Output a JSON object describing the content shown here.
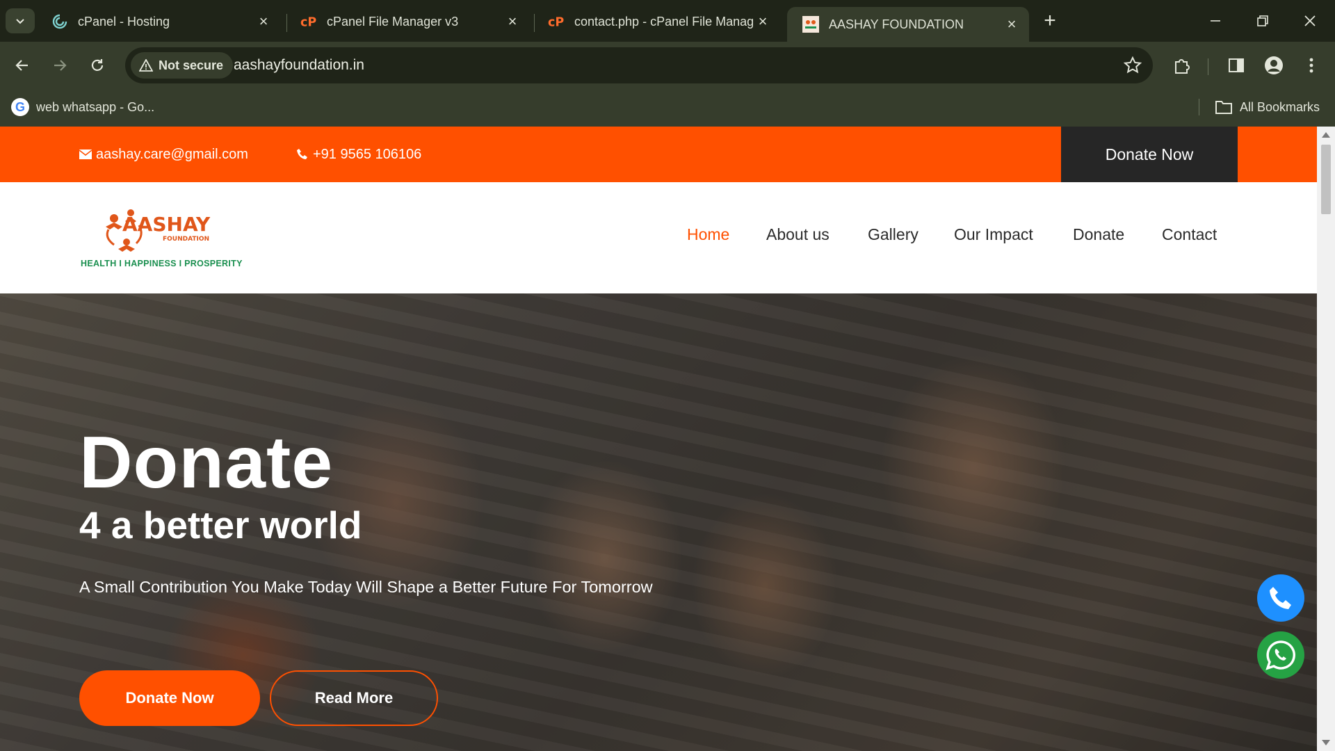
{
  "browser": {
    "tabs": [
      {
        "title": "cPanel - Hosting",
        "favicon": "cpanel-swirl-icon",
        "active": false
      },
      {
        "title": "cPanel File Manager v3",
        "favicon": "cpanel-icon",
        "active": false
      },
      {
        "title": "contact.php - cPanel File Manag",
        "favicon": "cpanel-icon",
        "active": false
      },
      {
        "title": "AASHAY FOUNDATION",
        "favicon": "aashay-logo-icon",
        "active": true
      }
    ],
    "security_label": "Not secure",
    "url": "aashayfoundation.in",
    "bookmarks": [
      {
        "label": "web whatsapp - Go...",
        "icon": "google-icon"
      }
    ],
    "all_bookmarks_label": "All Bookmarks"
  },
  "site": {
    "email": "aashay.care@gmail.com",
    "phone": "+91 9565 106106",
    "top_donate_label": "Donate Now",
    "logo": {
      "name": "AASHAY",
      "sub": "FOUNDATION",
      "tagline": "HEALTH I  HAPPINESS  I PROSPERITY"
    },
    "nav": [
      {
        "label": "Home",
        "active": true
      },
      {
        "label": "About us",
        "active": false
      },
      {
        "label": "Gallery",
        "active": false
      },
      {
        "label": "Our Impact",
        "active": false
      },
      {
        "label": "Donate",
        "active": false
      },
      {
        "label": "Contact",
        "active": false
      }
    ],
    "hero": {
      "title": "Donate",
      "subtitle": "4 a better world",
      "tagline": "A Small Contribution You Make Today Will Shape a Better Future For Tomorrow",
      "primary_button": "Donate Now",
      "secondary_button": "Read More"
    }
  },
  "colors": {
    "brand_orange": "#ff5000",
    "dark_button": "#262626",
    "browser_frame": "#363d2c",
    "call_button": "#1e90ff",
    "whatsapp_button": "#25a244"
  }
}
